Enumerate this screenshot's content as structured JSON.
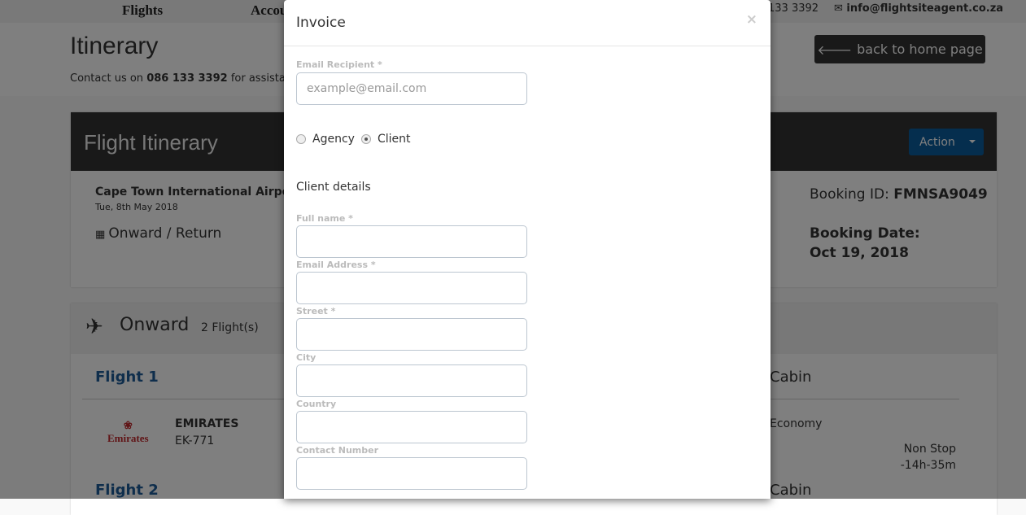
{
  "nav": {
    "items": [
      "Flights",
      "Accou"
    ],
    "phone": "133 3392",
    "email": "info@flightsiteagent.co.za"
  },
  "page": {
    "title": "Itinerary",
    "contact_prefix": "Contact us on ",
    "contact_phone": "086 133 3392",
    "contact_suffix": " for assistanc",
    "back_label": "back to home page"
  },
  "itinerary": {
    "title": "Flight Itinerary",
    "action_label": "Action",
    "airport": "Cape Town International Airport",
    "date": "Tue, 8th May 2018",
    "trip_type": "Onward / Return",
    "booking_id_label": "Booking ID: ",
    "booking_id": "FMNSA9049",
    "booking_date_label": "Booking Date:",
    "booking_date": "Oct 19, 2018"
  },
  "onward": {
    "title": "Onward",
    "count": "2 Flight(s)",
    "flights": [
      {
        "label": "Flight 1",
        "airline": "EMIRATES",
        "number": "EK-771",
        "logo": "Emirates",
        "cabin_header": "Cabin",
        "cabin": "Economy",
        "stops": "Non Stop",
        "duration": "-14h-35m"
      },
      {
        "label": "Flight 2",
        "cabin_header": "Cabin"
      }
    ]
  },
  "modal": {
    "title": "Invoice",
    "close": "×",
    "email_label": "Email Recipient *",
    "email_placeholder": "example@email.com",
    "radio_agency": "Agency",
    "radio_client": "Client",
    "selected": "Client",
    "section": "Client details",
    "fields": [
      "Full name *",
      "Email Address *",
      "Street *",
      "City",
      "Country",
      "Contact Number"
    ]
  }
}
